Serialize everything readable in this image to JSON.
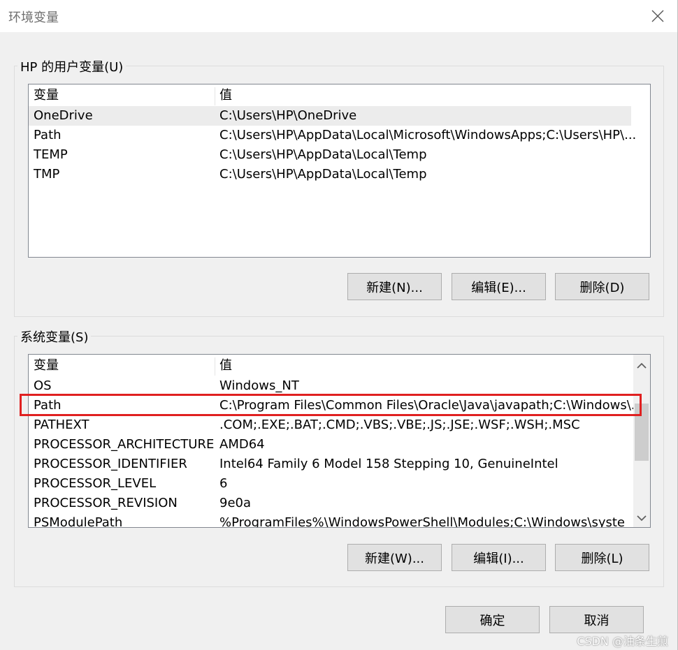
{
  "window": {
    "title": "环境变量"
  },
  "user_vars": {
    "legend": "HP 的用户变量(U)",
    "header": {
      "name": "变量",
      "value": "值"
    },
    "rows": [
      {
        "name": "OneDrive",
        "value": "C:\\Users\\HP\\OneDrive"
      },
      {
        "name": "Path",
        "value": "C:\\Users\\HP\\AppData\\Local\\Microsoft\\WindowsApps;C:\\Users\\HP\\..."
      },
      {
        "name": "TEMP",
        "value": "C:\\Users\\HP\\AppData\\Local\\Temp"
      },
      {
        "name": "TMP",
        "value": "C:\\Users\\HP\\AppData\\Local\\Temp"
      }
    ],
    "buttons": {
      "new": "新建(N)...",
      "edit": "编辑(E)...",
      "delete": "删除(D)"
    }
  },
  "system_vars": {
    "legend": "系统变量(S)",
    "header": {
      "name": "变量",
      "value": "值"
    },
    "rows": [
      {
        "name": "OS",
        "value": "Windows_NT"
      },
      {
        "name": "Path",
        "value": "C:\\Program Files\\Common Files\\Oracle\\Java\\javapath;C:\\Windows\\..."
      },
      {
        "name": "PATHEXT",
        "value": ".COM;.EXE;.BAT;.CMD;.VBS;.VBE;.JS;.JSE;.WSF;.WSH;.MSC"
      },
      {
        "name": "PROCESSOR_ARCHITECTURE",
        "value": "AMD64"
      },
      {
        "name": "PROCESSOR_IDENTIFIER",
        "value": "Intel64 Family 6 Model 158 Stepping 10, GenuineIntel"
      },
      {
        "name": "PROCESSOR_LEVEL",
        "value": "6"
      },
      {
        "name": "PROCESSOR_REVISION",
        "value": "9e0a"
      },
      {
        "name": "PSModulePath",
        "value": "%ProgramFiles%\\WindowsPowerShell\\Modules;C:\\Windows\\syste"
      }
    ],
    "buttons": {
      "new": "新建(W)...",
      "edit": "编辑(I)...",
      "delete": "删除(L)"
    }
  },
  "footer": {
    "ok": "确定",
    "cancel": "取消"
  },
  "watermark": "CSDN @油条生煎",
  "colors": {
    "highlight": "#e02020",
    "selected_row": "#ececec"
  }
}
